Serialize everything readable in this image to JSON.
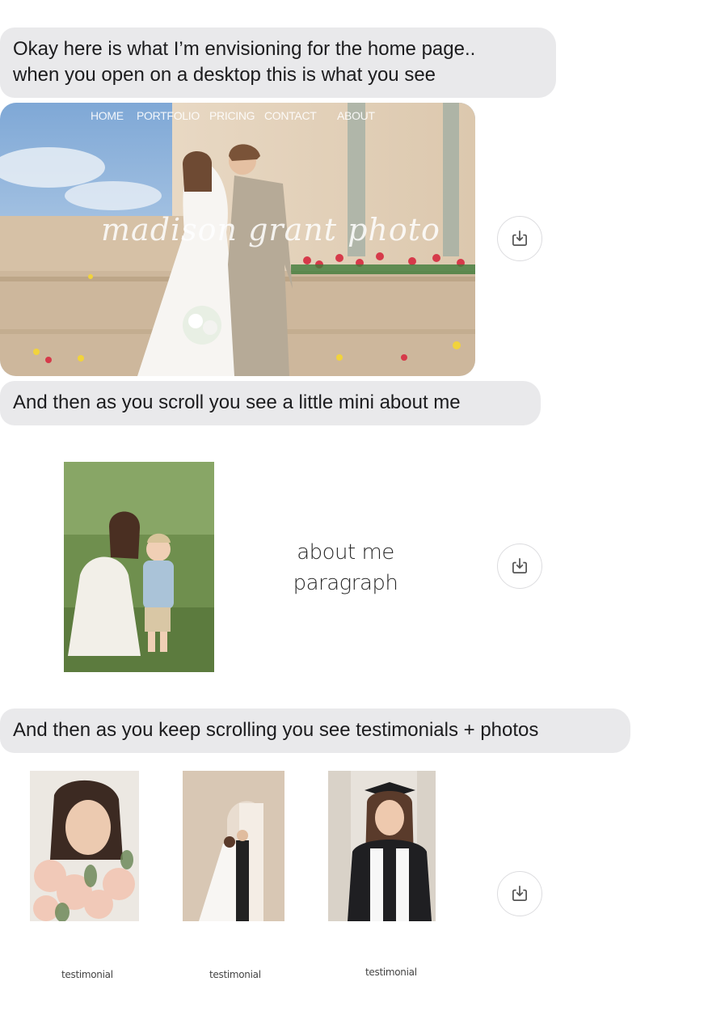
{
  "messages": {
    "msg1_line1": "Okay here is what I’m envisioning for the home page..",
    "msg1_line2": "when you open on a desktop this is what you see",
    "msg2": "And then as you scroll you see a little mini about me",
    "msg3": "And then as you keep scrolling you see testimonials + photos"
  },
  "hero": {
    "nav": [
      "HOME",
      "PORTFOLIO",
      "PRICING",
      "CONTACT",
      "ABOUT"
    ],
    "script_logo": "madison grant photo"
  },
  "about": {
    "line1": "about me",
    "line2": "paragraph"
  },
  "testimonials": {
    "labels": [
      "testimonial",
      "testimonial",
      "testimonial"
    ]
  },
  "icons": {
    "save": "save-to-downloads-icon"
  },
  "colors": {
    "bubble": "#e9e9eb",
    "text": "#1c1c1e"
  }
}
